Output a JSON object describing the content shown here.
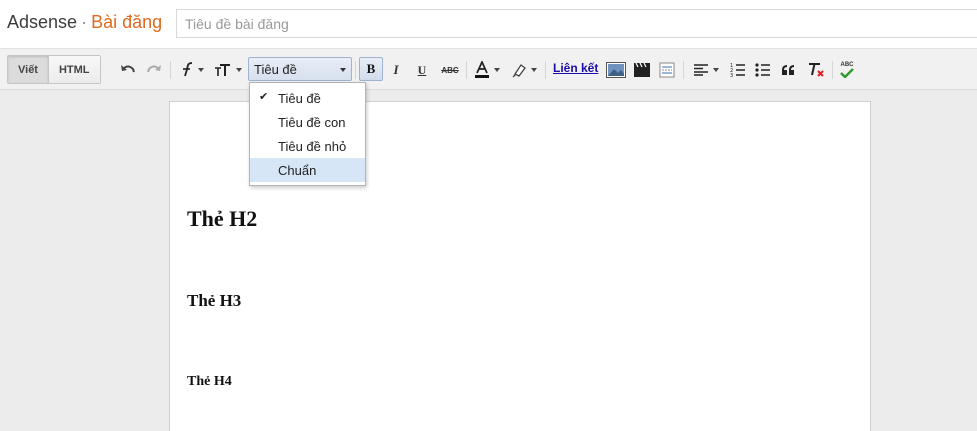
{
  "header": {
    "site_name": "Adsense",
    "separator": "·",
    "page_name": "Bài đăng",
    "title_placeholder": "Tiêu đề bài đăng"
  },
  "toolbar": {
    "modes": [
      "Viết",
      "HTML"
    ],
    "active_mode": "Viết",
    "format_value": "Tiêu đề",
    "bold_label": "B",
    "italic_label": "I",
    "underline_label": "U",
    "strike_label": "ABC",
    "link_label": "Liên kết",
    "spell_label": "ABC"
  },
  "format_menu": {
    "items": [
      "Tiêu đề",
      "Tiêu đề con",
      "Tiêu đề nhỏ",
      "Chuẩn"
    ],
    "checked": "Tiêu đề",
    "hovered": "Chuẩn",
    "check_mark": "✔"
  },
  "editor": {
    "h2": "Thẻ H2",
    "h3": "Thẻ H3",
    "h4": "Thẻ H4"
  },
  "colors": {
    "accent": "#dd6a1e",
    "link": "#1a0dab",
    "menu_hover": "#d6e6f7"
  }
}
